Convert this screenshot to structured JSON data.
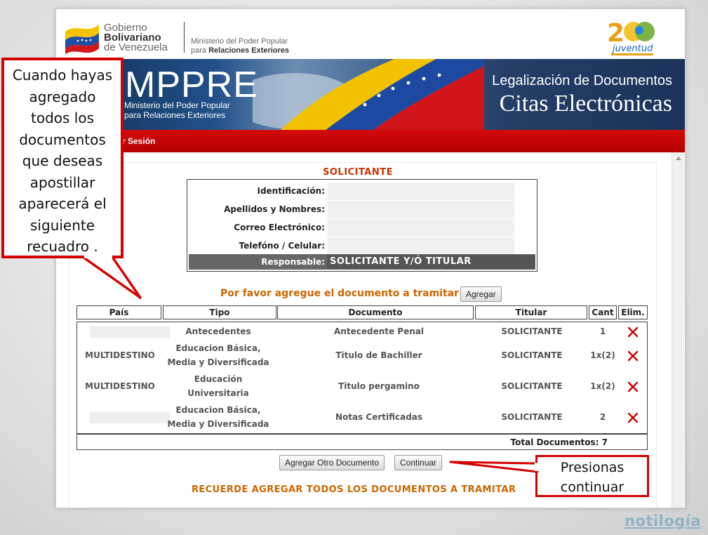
{
  "gov_header": {
    "line1": "Gobierno",
    "line2": "Bolivariano",
    "line3": "de Venezuela",
    "ministry_line1": "Ministerio del Poder Popular",
    "ministry_line2_prefix": "para",
    "ministry_line2_bold": "Relaciones Exteriores",
    "logo_text": "juventud"
  },
  "banner": {
    "title": "MPPRE",
    "sub1": "Ministerio del Poder Popular",
    "sub2": "para Relaciones Exteriores",
    "right1": "Legalización de Documentos",
    "right2": "Citas Electrónicas"
  },
  "nav": {
    "logout_label": "r Sesión"
  },
  "solicitante": {
    "title": "SOLICITANTE",
    "fields": [
      {
        "label": "Identificación:"
      },
      {
        "label": "Apellidos y Nombres:"
      },
      {
        "label": "Correo Electrónico:"
      },
      {
        "label": "Telefóno / Celular:"
      }
    ],
    "responsable_label": "Responsable:",
    "responsable_value": "SOLICITANTE Y/Ó TITULAR"
  },
  "add_prompt": {
    "text": "Por favor agregue el documento a tramitar",
    "button": "Agregar"
  },
  "table": {
    "headers": [
      "País",
      "Tipo",
      "Documento",
      "Titular",
      "Cant",
      "Elim."
    ],
    "rows": [
      {
        "pais": "",
        "tipo": [
          "Antecedentes"
        ],
        "documento": "Antecedente Penal",
        "titular": "SOLICITANTE",
        "cant": "1"
      },
      {
        "pais": "MULTIDESTINO",
        "tipo": [
          "Educacion Básica,",
          "Media y Diversificada"
        ],
        "documento": "Titulo de Bachiller",
        "titular": "SOLICITANTE",
        "cant": "1x(2)"
      },
      {
        "pais": "MULTIDESTINO",
        "tipo": [
          "Educación",
          "Universitaria"
        ],
        "documento": "Titulo pergamino",
        "titular": "SOLICITANTE",
        "cant": "1x(2)"
      },
      {
        "pais": "",
        "tipo": [
          "Educacion Básica,",
          "Media y Diversificada"
        ],
        "documento": "Notas Certificadas",
        "titular": "SOLICITANTE",
        "cant": "2"
      }
    ],
    "total": "Total Documentos: 7"
  },
  "actions": {
    "add_other": "Agregar Otro Documento",
    "continue": "Continuar"
  },
  "reminder": "RECUERDE AGREGAR TODOS LOS DOCUMENTOS A TRAMITAR",
  "annotations": {
    "left_lines": [
      "Cuando hayas",
      "agregado",
      "todos los",
      "documentos",
      "que deseas",
      "apostillar",
      "aparecerá el",
      "siguiente",
      "recuadro ."
    ],
    "right_lines": [
      "Presionas",
      "continuar"
    ]
  },
  "watermark": "notilogía",
  "colors": {
    "nav_red": "#c00000",
    "title_red": "#cc3300",
    "prompt_orange": "#cc6600",
    "delete_red": "#cc0000",
    "callout_red": "#d40000"
  }
}
